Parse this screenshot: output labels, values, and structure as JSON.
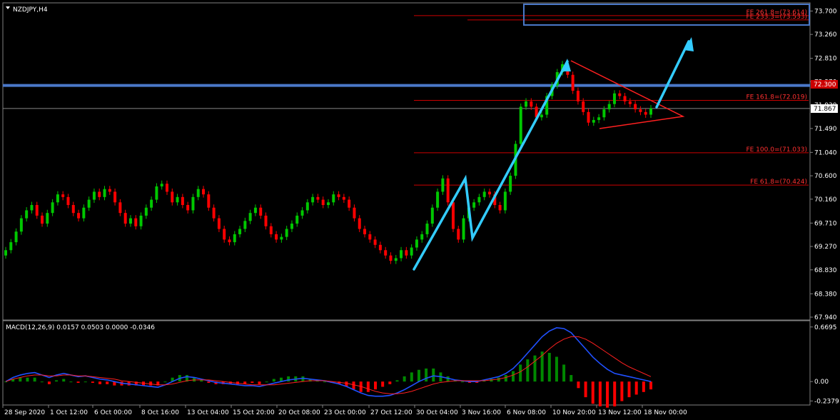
{
  "window": {
    "symbol_title": "NZDJPY,H4"
  },
  "price_axis": {
    "ticks": [
      "73.700",
      "73.260",
      "72.810",
      "72.370",
      "71.930",
      "71.490",
      "71.040",
      "70.600",
      "70.160",
      "69.710",
      "69.270",
      "68.830",
      "68.380",
      "67.940"
    ],
    "current_price_label": "71.867",
    "resistance_label": "72.300"
  },
  "time_axis": {
    "labels": [
      "28 Sep 2020",
      "1 Oct 12:00",
      "6 Oct 00:00",
      "8 Oct 16:00",
      "13 Oct 04:00",
      "15 Oct 20:00",
      "20 Oct 08:00",
      "23 Oct 00:00",
      "27 Oct 12:00",
      "30 Oct 04:00",
      "3 Nov 16:00",
      "6 Nov 08:00",
      "10 Nov 20:00",
      "13 Nov 12:00",
      "18 Nov 00:00"
    ]
  },
  "fib_levels": [
    {
      "label": "FE 261.8=(73.614)",
      "price": 73.614
    },
    {
      "label": "FE 233.3=(73.533)",
      "price": 73.533
    },
    {
      "label": "FE 161.8=(72.019)",
      "price": 72.019
    },
    {
      "label": "FE 100.0=(71.033)",
      "price": 71.033
    },
    {
      "label": "FE 61.8=(70.424)",
      "price": 70.424
    }
  ],
  "indicator": {
    "macd_label": "MACD(12,26,9) 0.0157 0.0503 0.0000 -0.0346",
    "axis_ticks": [
      "0.6695",
      "0.00",
      "-0.2379"
    ]
  },
  "colors": {
    "bull_candle": "#00c800",
    "bear_candle": "#ff0000",
    "resistance_line": "#4a78c8",
    "arrow": "#33ccff",
    "triangle": "#ff2020",
    "fib_line": "#cc0000",
    "macd_line": "#2050ff",
    "signal_line": "#ff2020",
    "histogram_pos": "#008800",
    "histogram_neg": "#ff0000"
  },
  "chart_data": {
    "type": "candlestick",
    "symbol": "NZDJPY",
    "timeframe": "H4",
    "ylim": [
      67.94,
      73.85
    ],
    "close_series": [
      69.2,
      69.35,
      69.55,
      69.8,
      69.95,
      70.05,
      69.85,
      69.7,
      69.9,
      70.1,
      70.25,
      70.2,
      70.05,
      69.9,
      69.8,
      70.0,
      70.15,
      70.3,
      70.2,
      70.35,
      70.3,
      70.1,
      69.9,
      69.7,
      69.8,
      69.65,
      69.85,
      70.0,
      70.15,
      70.4,
      70.45,
      70.3,
      70.1,
      70.2,
      70.05,
      69.95,
      70.2,
      70.35,
      70.25,
      70.0,
      69.8,
      69.6,
      69.4,
      69.35,
      69.5,
      69.6,
      69.75,
      69.9,
      70.0,
      69.85,
      69.65,
      69.5,
      69.4,
      69.45,
      69.6,
      69.7,
      69.85,
      69.95,
      70.1,
      70.2,
      70.15,
      70.05,
      70.1,
      70.25,
      70.2,
      70.15,
      70.0,
      69.8,
      69.6,
      69.5,
      69.4,
      69.3,
      69.2,
      69.1,
      69.0,
      69.05,
      69.2,
      69.1,
      69.25,
      69.4,
      69.5,
      69.7,
      70.0,
      70.3,
      70.55,
      70.1,
      69.6,
      69.4,
      69.8,
      70.0,
      70.1,
      70.2,
      70.3,
      70.25,
      70.05,
      69.95,
      70.3,
      70.6,
      71.2,
      71.9,
      72.0,
      71.9,
      71.7,
      71.75,
      72.1,
      72.3,
      72.55,
      72.7,
      72.5,
      72.2,
      72.0,
      71.8,
      71.6,
      71.65,
      71.7,
      71.85,
      71.95,
      72.15,
      72.1,
      72.0,
      71.95,
      71.85,
      71.8,
      71.75,
      71.87
    ],
    "macd_series": [
      0.0,
      0.05,
      0.08,
      0.1,
      0.11,
      0.08,
      0.05,
      0.08,
      0.1,
      0.08,
      0.06,
      0.07,
      0.05,
      0.03,
      0.02,
      0.0,
      -0.02,
      -0.03,
      -0.04,
      -0.05,
      -0.06,
      -0.07,
      -0.04,
      0.0,
      0.04,
      0.06,
      0.05,
      0.03,
      0.01,
      -0.01,
      -0.02,
      -0.03,
      -0.04,
      -0.05,
      -0.05,
      -0.06,
      -0.04,
      -0.02,
      0.0,
      0.02,
      0.03,
      0.04,
      0.03,
      0.02,
      0.01,
      -0.01,
      -0.03,
      -0.06,
      -0.1,
      -0.14,
      -0.17,
      -0.18,
      -0.18,
      -0.17,
      -0.14,
      -0.1,
      -0.05,
      0.0,
      0.04,
      0.07,
      0.06,
      0.04,
      0.02,
      0.01,
      0.0,
      0.0,
      0.02,
      0.04,
      0.06,
      0.1,
      0.16,
      0.25,
      0.35,
      0.45,
      0.55,
      0.62,
      0.66,
      0.65,
      0.6,
      0.5,
      0.4,
      0.3,
      0.22,
      0.15,
      0.1,
      0.08,
      0.06,
      0.04,
      0.02,
      0.0
    ],
    "signal_series": [
      0.0,
      0.03,
      0.05,
      0.07,
      0.08,
      0.08,
      0.07,
      0.07,
      0.08,
      0.08,
      0.07,
      0.07,
      0.06,
      0.05,
      0.04,
      0.03,
      0.01,
      0.0,
      -0.01,
      -0.02,
      -0.03,
      -0.04,
      -0.04,
      -0.03,
      -0.01,
      0.01,
      0.02,
      0.02,
      0.02,
      0.01,
      0.0,
      -0.01,
      -0.02,
      -0.03,
      -0.04,
      -0.04,
      -0.04,
      -0.04,
      -0.03,
      -0.02,
      -0.01,
      0.0,
      0.01,
      0.01,
      0.01,
      0.0,
      -0.01,
      -0.02,
      -0.04,
      -0.06,
      -0.09,
      -0.12,
      -0.14,
      -0.15,
      -0.15,
      -0.14,
      -0.12,
      -0.09,
      -0.06,
      -0.03,
      -0.01,
      0.0,
      0.01,
      0.01,
      0.01,
      0.01,
      0.01,
      0.02,
      0.03,
      0.05,
      0.08,
      0.12,
      0.18,
      0.25,
      0.32,
      0.4,
      0.47,
      0.52,
      0.55,
      0.55,
      0.52,
      0.47,
      0.41,
      0.35,
      0.29,
      0.23,
      0.18,
      0.14,
      0.1,
      0.06
    ],
    "macd_ylim": [
      -0.2379,
      0.6695
    ]
  }
}
